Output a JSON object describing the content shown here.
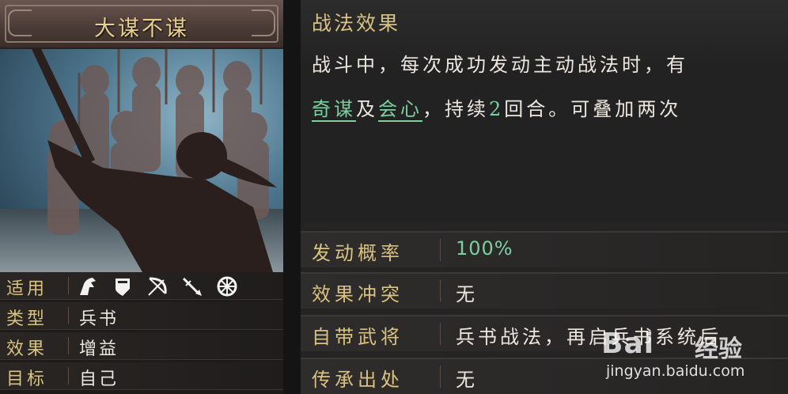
{
  "card": {
    "title": "大谋不谋",
    "rows": [
      {
        "label": "适用",
        "value": ""
      },
      {
        "label": "类型",
        "value": "兵书"
      },
      {
        "label": "效果",
        "value": "增益"
      },
      {
        "label": "目标",
        "value": "自己"
      }
    ],
    "troop_icons": [
      "cavalry-icon",
      "shield-icon",
      "bow-icon",
      "spear-icon",
      "siege-wheel-icon"
    ]
  },
  "panel": {
    "effect_title": "战法效果",
    "desc_line1": "战斗中，每次成功发动主动战法时，有",
    "desc_kw1": "奇谋",
    "desc_mid": "及",
    "desc_kw2": "会心",
    "desc_tail1": "，持续",
    "desc_num": "2",
    "desc_tail2": "回合。可叠加两次",
    "props": [
      {
        "label": "发动概率",
        "value": "100%"
      },
      {
        "label": "效果冲突",
        "value": "无"
      },
      {
        "label": "自带武将",
        "value": "兵书战法，再启兵书系统后"
      },
      {
        "label": "传承出处",
        "value": "无"
      }
    ]
  },
  "watermark": {
    "logo": "Bai",
    "cn": "经验",
    "url": "jingyan.baidu.com"
  },
  "colors": {
    "gold": "#d9c282",
    "green": "#7ccfa0",
    "text": "#ece7df"
  }
}
